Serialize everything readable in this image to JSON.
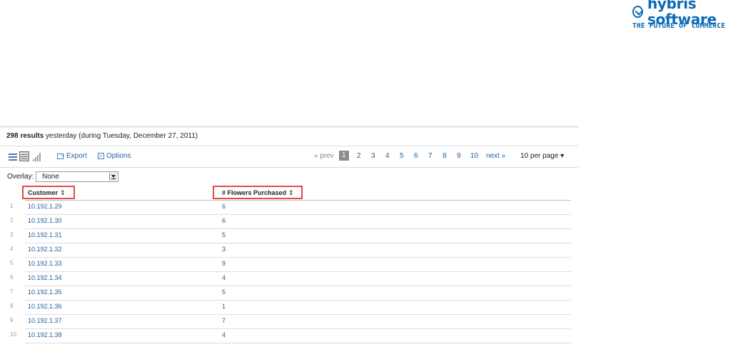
{
  "logo": {
    "name": "hybris software",
    "tagline": "THE FUTURE OF COMMERCE"
  },
  "summary": {
    "count": "298 results",
    "rest": " yesterday (during Tuesday, December 27, 2011)"
  },
  "toolbar": {
    "view_icons": [
      "list-view-icon",
      "table-view-icon",
      "chart-view-icon"
    ],
    "export_label": "Export",
    "options_label": "Options"
  },
  "pagination": {
    "prev_label": "« prev",
    "current_page": "1",
    "pages": [
      "2",
      "3",
      "4",
      "5",
      "6",
      "7",
      "8",
      "9",
      "10"
    ],
    "next_label": "next »",
    "per_page_label": "10 per page ▾"
  },
  "overlay": {
    "label": "Overlay:",
    "value": "None"
  },
  "table": {
    "columns": [
      "Customer",
      "# Flowers Purchased"
    ],
    "sort_glyph": "⇕",
    "highlight_color": "#e24a4a",
    "rows": [
      {
        "index": "1",
        "customer": "10.192.1.29",
        "flowers": "6"
      },
      {
        "index": "2",
        "customer": "10.192.1.30",
        "flowers": "6"
      },
      {
        "index": "3",
        "customer": "10.192.1.31",
        "flowers": "5"
      },
      {
        "index": "4",
        "customer": "10.192.1.32",
        "flowers": "3"
      },
      {
        "index": "5",
        "customer": "10.192.1.33",
        "flowers": "9"
      },
      {
        "index": "6",
        "customer": "10.192.1.34",
        "flowers": "4"
      },
      {
        "index": "7",
        "customer": "10.192.1.35",
        "flowers": "5"
      },
      {
        "index": "8",
        "customer": "10.192.1.36",
        "flowers": "1"
      },
      {
        "index": "9",
        "customer": "10.192.1.37",
        "flowers": "7"
      },
      {
        "index": "10",
        "customer": "10.192.1.38",
        "flowers": "4"
      }
    ]
  },
  "colors": {
    "link": "#1f5f9e",
    "brand": "#0a6ab5"
  }
}
